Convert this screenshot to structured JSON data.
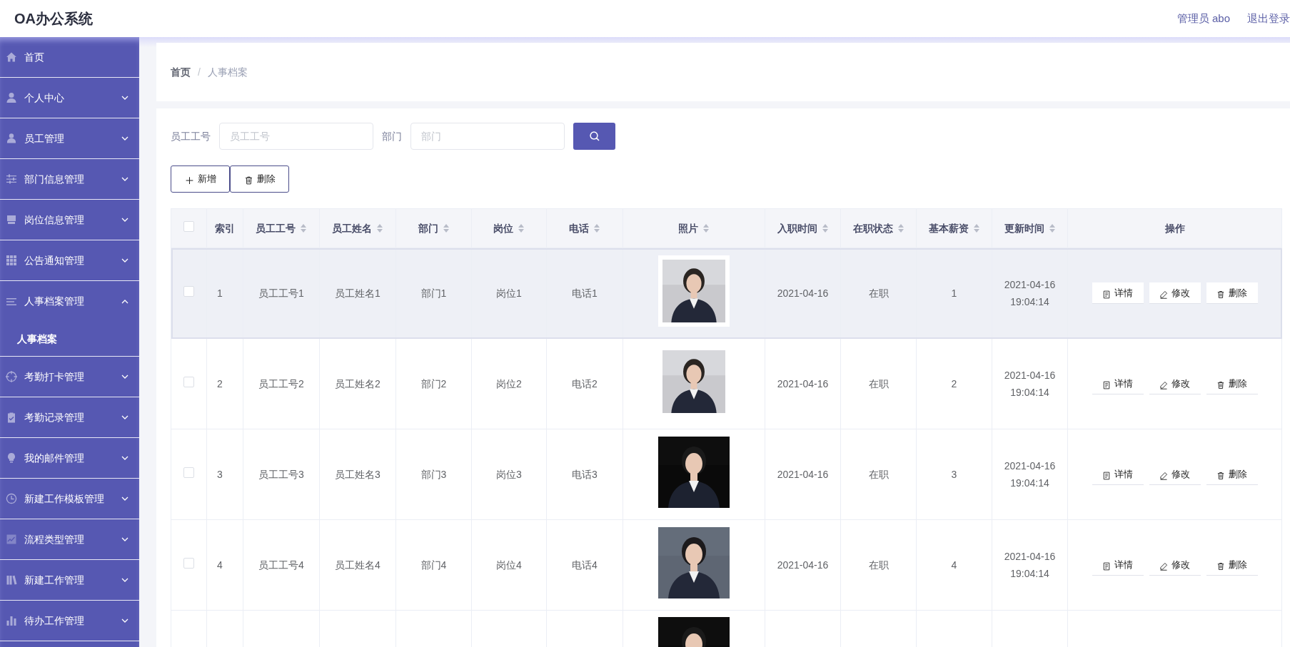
{
  "header": {
    "title": "OA办公系统",
    "user": "管理员 abo",
    "logout": "退出登录"
  },
  "sidebar": {
    "items": [
      {
        "label": "首页",
        "expandable": false,
        "expanded": false
      },
      {
        "label": "个人中心",
        "expandable": true,
        "expanded": false
      },
      {
        "label": "员工管理",
        "expandable": true,
        "expanded": false
      },
      {
        "label": "部门信息管理",
        "expandable": true,
        "expanded": false
      },
      {
        "label": "岗位信息管理",
        "expandable": true,
        "expanded": false
      },
      {
        "label": "公告通知管理",
        "expandable": true,
        "expanded": false
      },
      {
        "label": "人事档案管理",
        "expandable": true,
        "expanded": true,
        "children": [
          {
            "label": "人事档案"
          }
        ]
      },
      {
        "label": "考勤打卡管理",
        "expandable": true,
        "expanded": false
      },
      {
        "label": "考勤记录管理",
        "expandable": true,
        "expanded": false
      },
      {
        "label": "我的邮件管理",
        "expandable": true,
        "expanded": false
      },
      {
        "label": "新建工作模板管理",
        "expandable": true,
        "expanded": false
      },
      {
        "label": "流程类型管理",
        "expandable": true,
        "expanded": false
      },
      {
        "label": "新建工作管理",
        "expandable": true,
        "expanded": false
      },
      {
        "label": "待办工作管理",
        "expandable": true,
        "expanded": false
      }
    ]
  },
  "breadcrumb": {
    "separator": "/",
    "items": [
      "首页",
      "人事档案"
    ]
  },
  "search": {
    "fields": [
      {
        "label": "员工工号",
        "placeholder": "员工工号"
      },
      {
        "label": "部门",
        "placeholder": "部门"
      }
    ]
  },
  "toolbar": [
    "新增",
    "删除"
  ],
  "table": {
    "select_all": {
      "checked": false
    },
    "columns": [
      {
        "label": "索引",
        "sortable": false
      },
      {
        "label": "员工工号",
        "sortable": true
      },
      {
        "label": "员工姓名",
        "sortable": true
      },
      {
        "label": "部门",
        "sortable": true
      },
      {
        "label": "岗位",
        "sortable": true
      },
      {
        "label": "电话",
        "sortable": true
      },
      {
        "label": "照片",
        "sortable": true
      },
      {
        "label": "入职时间",
        "sortable": true
      },
      {
        "label": "在职状态",
        "sortable": true
      },
      {
        "label": "基本薪资",
        "sortable": true
      },
      {
        "label": "更新时间",
        "sortable": true
      },
      {
        "label": "操作",
        "sortable": false
      }
    ],
    "rows": [
      {
        "checked": false,
        "hovered": true,
        "index": "1",
        "emp_no": "员工工号1",
        "name": "员工姓名1",
        "dept": "部门1",
        "post": "岗位1",
        "phone": "电话1",
        "photo": {
          "kind": "picture"
        },
        "hire_date": "2021-04-16",
        "status": "在职",
        "salary": "1",
        "updated": [
          "2021-04-16",
          "19:04:14"
        ],
        "actions": [
          "详情",
          "修改",
          "删除"
        ]
      },
      {
        "checked": false,
        "hovered": false,
        "index": "2",
        "emp_no": "员工工号2",
        "name": "员工姓名2",
        "dept": "部门2",
        "post": "岗位2",
        "phone": "电话2",
        "photo": {
          "kind": "picture"
        },
        "hire_date": "2021-04-16",
        "status": "在职",
        "salary": "2",
        "updated": [
          "2021-04-16",
          "19:04:14"
        ],
        "actions": [
          "详情",
          "修改",
          "删除"
        ]
      },
      {
        "checked": false,
        "hovered": false,
        "index": "3",
        "emp_no": "员工工号3",
        "name": "员工姓名3",
        "dept": "部门3",
        "post": "岗位3",
        "phone": "电话3",
        "photo": {
          "kind": "picture"
        },
        "hire_date": "2021-04-16",
        "status": "在职",
        "salary": "3",
        "updated": [
          "2021-04-16",
          "19:04:14"
        ],
        "actions": [
          "详情",
          "修改",
          "删除"
        ]
      },
      {
        "checked": false,
        "hovered": false,
        "index": "4",
        "emp_no": "员工工号4",
        "name": "员工姓名4",
        "dept": "部门4",
        "post": "岗位4",
        "phone": "电话4",
        "photo": {
          "kind": "picture"
        },
        "hire_date": "2021-04-16",
        "status": "在职",
        "salary": "4",
        "updated": [
          "2021-04-16",
          "19:04:14"
        ],
        "actions": [
          "详情",
          "修改",
          "删除"
        ]
      },
      {
        "hovered": false,
        "photo": {
          "kind": "picture"
        }
      }
    ]
  }
}
